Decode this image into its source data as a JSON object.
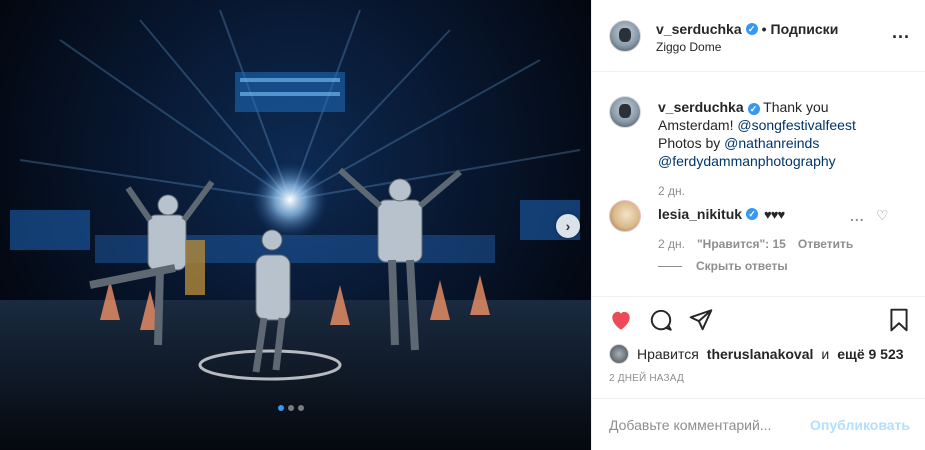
{
  "photo": {
    "alt_icon": "carousel-next-icon",
    "carousel_next": "›",
    "dots": 3,
    "active_dot": 0
  },
  "header": {
    "username": "v_serduchka",
    "separator": "•",
    "follow": "Подписки",
    "location": "Ziggo Dome",
    "more": "..."
  },
  "caption": {
    "username": "v_serduchka",
    "text_start": "Thank you Amsterdam!",
    "mention1": "@songfestivalfeest",
    "text_mid": "Photos by",
    "mention2": "@nathanreinds",
    "mention3": "@ferdydammanphotography",
    "time": "2 дн."
  },
  "comment": {
    "username": "lesia_nikituk",
    "text": "♥♥♥",
    "time": "2 дн.",
    "likes": "\"Нравится\": 15",
    "reply": "Ответить",
    "hide_replies": "Скрыть ответы",
    "more": "...",
    "like_icon": "♡"
  },
  "likes": {
    "prefix": "Нравится",
    "user": "theruslanakoval",
    "mid": "и",
    "rest": "ещё 9 523"
  },
  "date": "2 ДНЕЙ НАЗАД",
  "add_comment": {
    "placeholder": "Добавьте комментарий...",
    "post": "Опубликовать"
  },
  "colors": {
    "like_red": "#ed4956",
    "link_blue": "#003569",
    "verified": "#3897f0",
    "post_disabled": "#b2dffc"
  }
}
